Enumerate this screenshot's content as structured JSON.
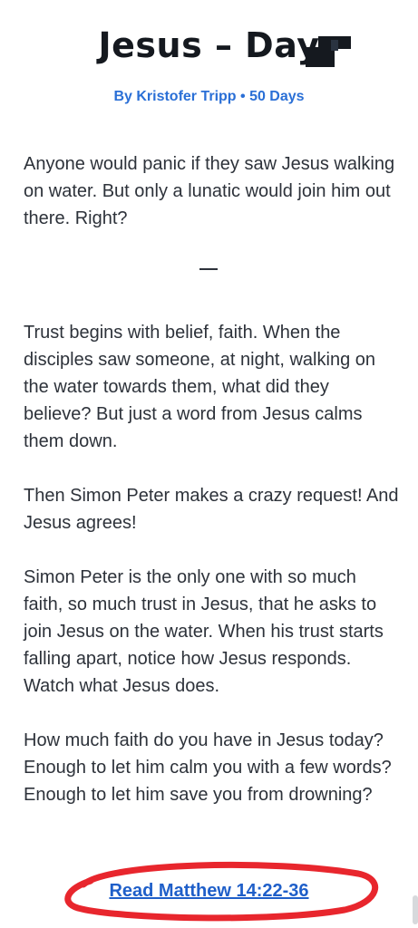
{
  "header": {
    "title": "Jesus – Day",
    "byline": "By Kristofer Tripp • 50 Days"
  },
  "content": {
    "intro": "Anyone would panic if they saw Jesus walking on water. But only a lunatic would join him out there. Right?",
    "divider": "—",
    "paragraphs": [
      "Trust begins with belief, faith. When the disciples saw someone, at night, walking on the water towards them, what did they believe? But just a word from Jesus calms them down.",
      "Then Simon Peter makes a crazy request! And Jesus agrees!",
      "Simon Peter is the only one with so much faith, so much trust in Jesus, that he asks to join Jesus on the water. When his trust starts falling apart, notice how Jesus responds. Watch what Jesus does.",
      "How much faith do you have in Jesus today? Enough to let him calm you with a few words? Enough to let him save you from drowning?"
    ]
  },
  "footer": {
    "read_link": "Read Matthew 14:22-36"
  },
  "colors": {
    "link": "#1f5fc9",
    "byline": "#2a6fd6",
    "annotation": "#e8262d"
  }
}
